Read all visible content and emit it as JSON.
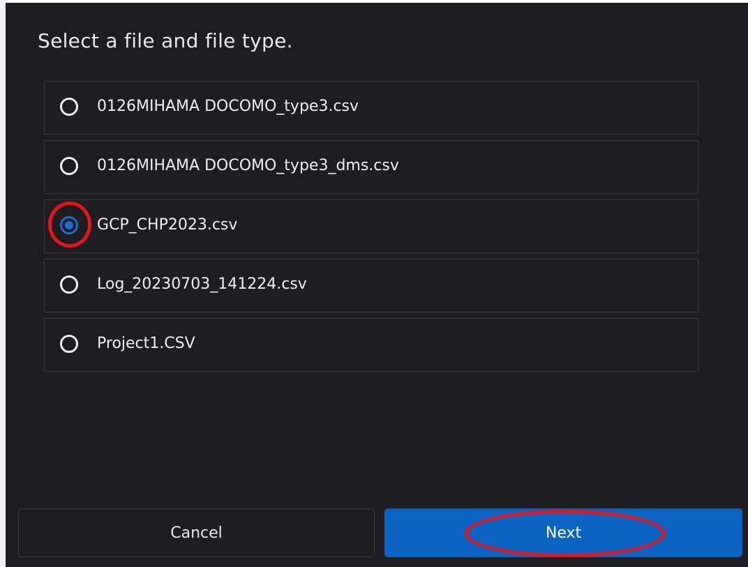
{
  "dialog": {
    "title": "Select a file and file type."
  },
  "files": [
    {
      "label": "0126MIHAMA DOCOMO_type3.csv",
      "selected": false
    },
    {
      "label": "0126MIHAMA DOCOMO_type3_dms.csv",
      "selected": false
    },
    {
      "label": "GCP_CHP2023.csv",
      "selected": true
    },
    {
      "label": "Log_20230703_141224.csv",
      "selected": false
    },
    {
      "label": "Project1.CSV",
      "selected": false
    }
  ],
  "buttons": {
    "cancel_label": "Cancel",
    "next_label": "Next"
  },
  "colors": {
    "background": "#1e1e20",
    "accent": "#0b64c1",
    "annotation": "#e6151b"
  }
}
